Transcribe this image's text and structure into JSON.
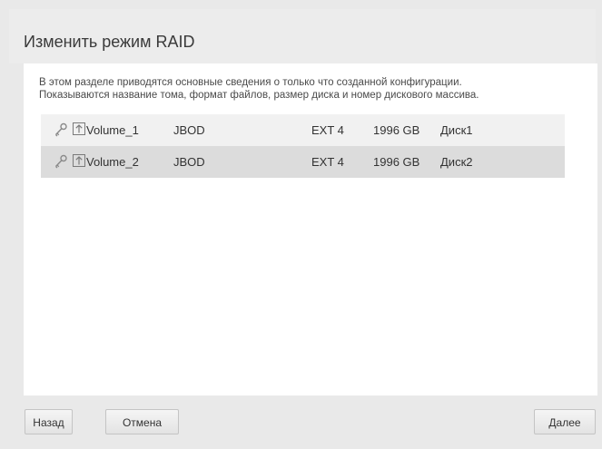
{
  "dialog": {
    "title": "Изменить режим RAID"
  },
  "description": {
    "line1": "В этом разделе приводятся основные сведения о только что созданной конфигурации.",
    "line2": "Показываются название тома, формат файлов, размер диска и номер дискового массива."
  },
  "volumes": [
    {
      "name": "Volume_1",
      "raid": "JBOD",
      "fs": "EXT 4",
      "size": "1996 GB",
      "disk": "Диск1",
      "icons": [
        "key-icon",
        "upload-icon"
      ]
    },
    {
      "name": "Volume_2",
      "raid": "JBOD",
      "fs": "EXT 4",
      "size": "1996 GB",
      "disk": "Диск2",
      "icons": [
        "key-icon",
        "upload-icon"
      ]
    }
  ],
  "buttons": {
    "back": "Назад",
    "cancel": "Отмена",
    "next": "Далее"
  },
  "colors": {
    "background": "#e9e9e9",
    "panel": "#ffffff",
    "row_light": "#f1f1f1",
    "row_dark": "#dcdcdc",
    "text": "#333333"
  }
}
